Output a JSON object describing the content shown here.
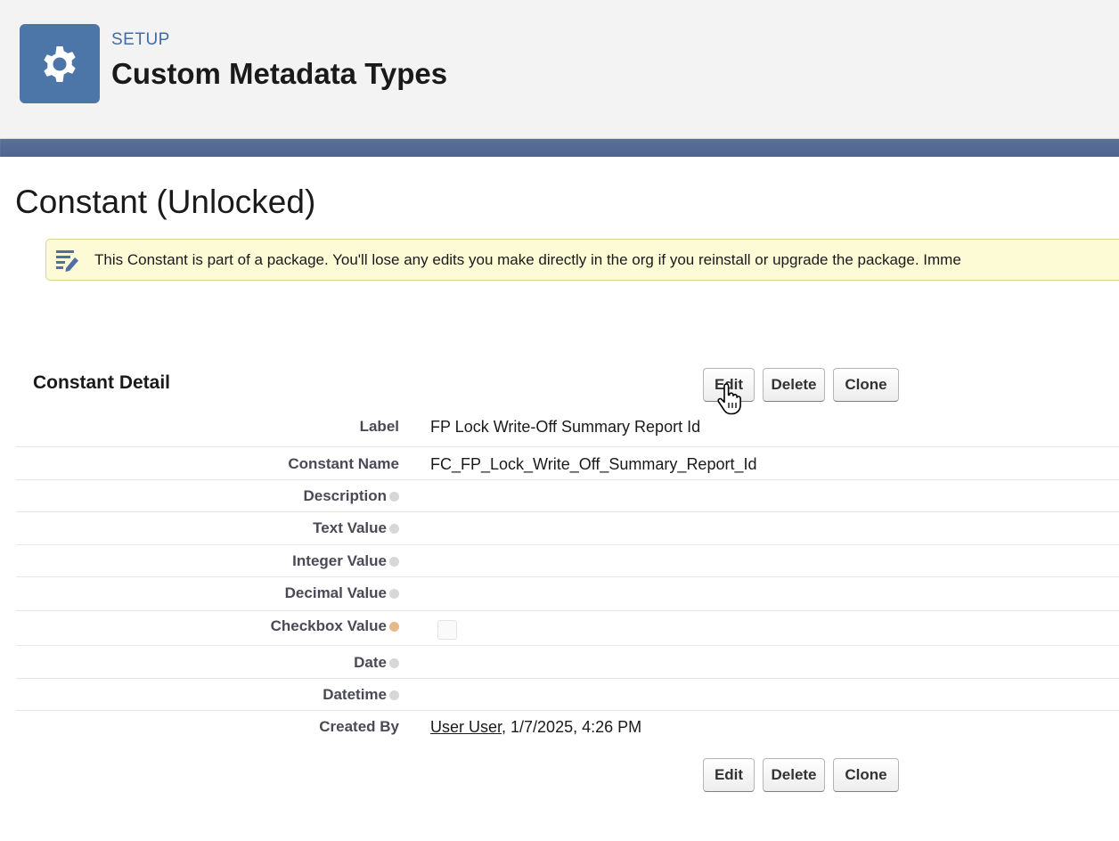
{
  "header": {
    "eyebrow": "SETUP",
    "title": "Custom Metadata Types",
    "icon": "gear-icon",
    "icon_bg": "#4d76a8"
  },
  "page": {
    "title": "Constant (Unlocked)"
  },
  "warning": {
    "icon": "edit-note-icon",
    "text": "This Constant is part of a package. You'll lose any edits you make directly in the org if you reinstall or upgrade the package. Imme"
  },
  "detail": {
    "title": "Constant Detail",
    "buttons": {
      "edit": "Edit",
      "delete": "Delete",
      "clone": "Clone"
    },
    "fields": [
      {
        "label": "Label",
        "value": "FP Lock Write-Off Summary Report Id"
      },
      {
        "label": "Constant Name",
        "value": "FC_FP_Lock_Write_Off_Summary_Report_Id"
      },
      {
        "label": "Description",
        "value": ""
      },
      {
        "label": "Text Value",
        "value": ""
      },
      {
        "label": "Integer Value",
        "value": ""
      },
      {
        "label": "Decimal Value",
        "value": ""
      },
      {
        "label": "Checkbox Value",
        "value": "",
        "checked": false
      },
      {
        "label": "Date",
        "value": ""
      },
      {
        "label": "Datetime",
        "value": ""
      },
      {
        "label": "Created By",
        "user": "User User",
        "value": ", 1/7/2025, 4:26 PM"
      }
    ]
  }
}
